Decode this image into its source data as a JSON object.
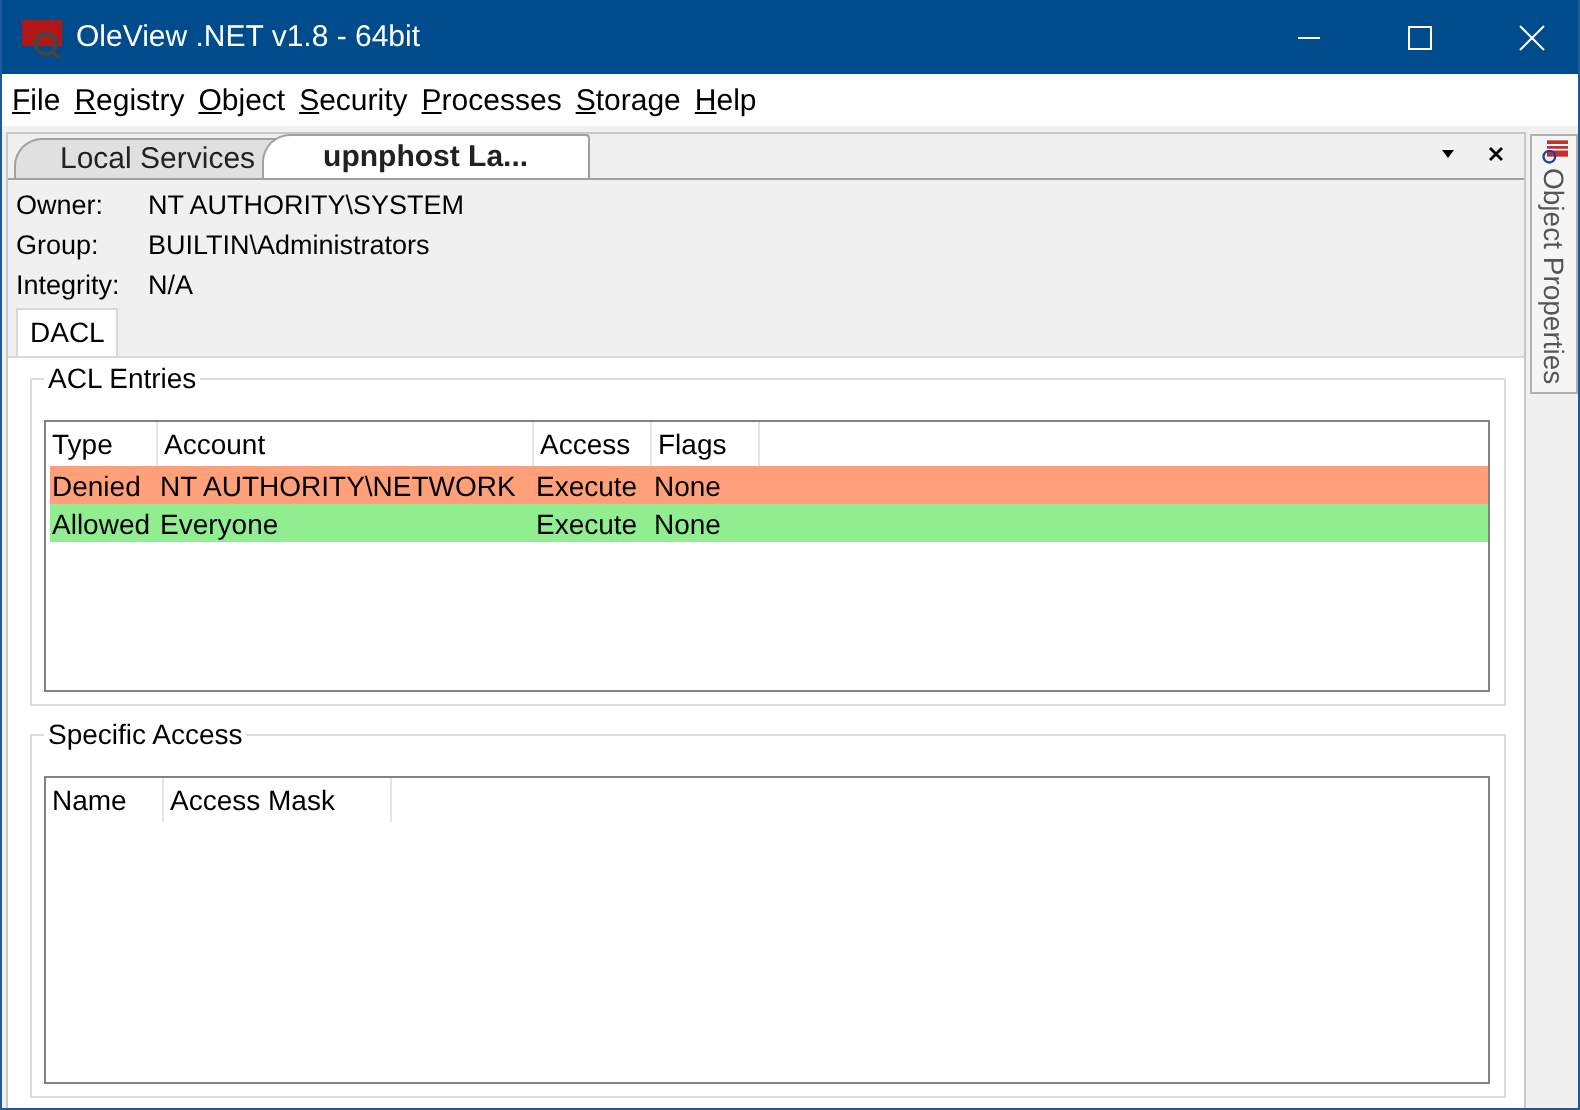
{
  "window": {
    "title": "OleView .NET v1.8 - 64bit"
  },
  "menu": [
    "File",
    "Registry",
    "Object",
    "Security",
    "Processes",
    "Storage",
    "Help"
  ],
  "document_tabs": [
    {
      "label": "Local Services",
      "selected": false
    },
    {
      "label": "upnphost La...",
      "selected": true
    }
  ],
  "properties": [
    {
      "label": "Owner:",
      "value": "NT AUTHORITY\\SYSTEM"
    },
    {
      "label": "Group:",
      "value": "BUILTIN\\Administrators"
    },
    {
      "label": "Integrity:",
      "value": "N/A"
    }
  ],
  "acl_tabs": [
    {
      "label": "DACL",
      "selected": true
    }
  ],
  "acl_entries": {
    "title": "ACL Entries",
    "columns": [
      "Type",
      "Account",
      "Access",
      "Flags"
    ],
    "rows": [
      {
        "cells": [
          "Denied",
          "NT AUTHORITY\\NETWORK",
          "Execute",
          "None"
        ],
        "color": "#ffa07a"
      },
      {
        "cells": [
          "Allowed",
          "Everyone",
          "Execute",
          "None"
        ],
        "color": "#90ee90"
      }
    ]
  },
  "specific_access": {
    "title": "Specific Access",
    "columns": [
      "Name",
      "Access Mask"
    ]
  },
  "side_panel": {
    "label": "Object Properties"
  }
}
